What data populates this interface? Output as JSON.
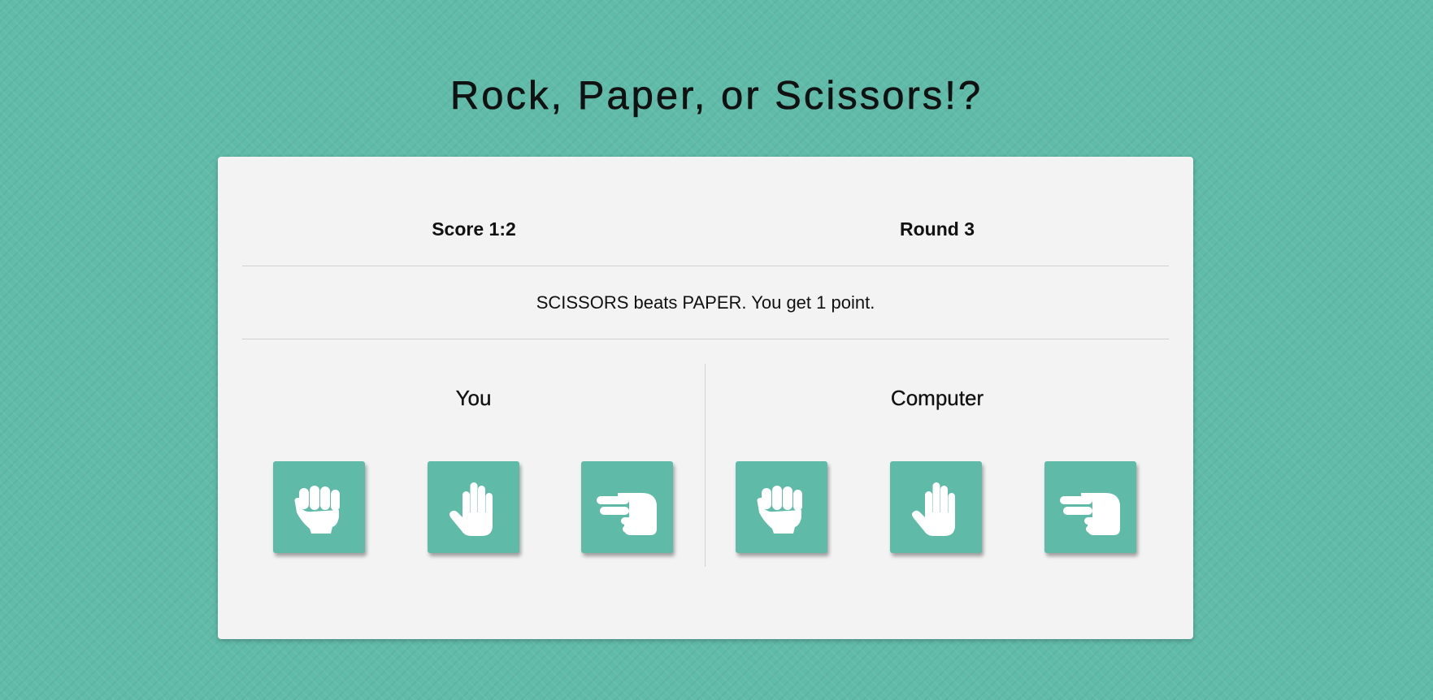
{
  "title": "Rock, Paper, or Scissors!?",
  "stats": {
    "score": "Score 1:2",
    "round": "Round 3"
  },
  "message": "SCISSORS beats PAPER. You get 1 point.",
  "players": {
    "you": {
      "label": "You",
      "choices": [
        "rock",
        "paper",
        "scissors"
      ]
    },
    "computer": {
      "label": "Computer",
      "choices": [
        "rock",
        "paper",
        "scissors"
      ]
    }
  },
  "icons": {
    "rock": "rock-hand-icon",
    "paper": "paper-hand-icon",
    "scissors": "scissors-hand-icon"
  },
  "colors": {
    "background": "#60bba9",
    "card": "#f3f3f3",
    "button": "#5fbaa8",
    "icon": "#ffffff",
    "text": "#111111"
  }
}
